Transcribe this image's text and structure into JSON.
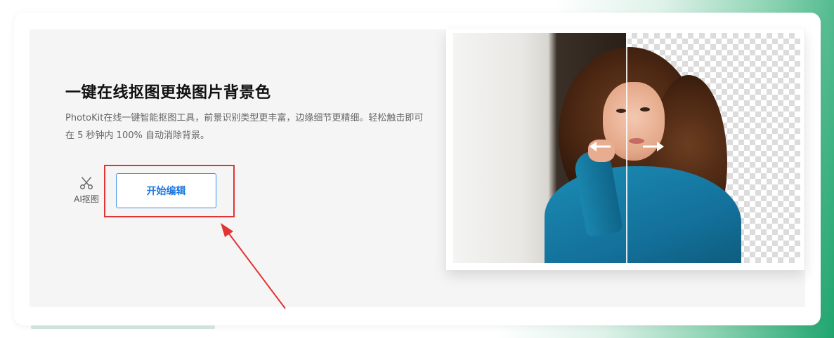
{
  "hero": {
    "title": "一键在线抠图更换图片背景色",
    "description": "PhotoKit在线一键智能抠图工具，前景识别类型更丰富，边缘细节更精细。轻松触击即可在 5 秒钟内 100% 自动消除背景。"
  },
  "tool": {
    "icon": "scissors-icon",
    "label": "AI抠图"
  },
  "actions": {
    "start_label": "开始编辑"
  },
  "annotation": {
    "highlight_color": "#e23434"
  },
  "preview": {
    "left_arrow_icon": "arrow-left-icon",
    "right_arrow_icon": "arrow-right-icon"
  },
  "colors": {
    "accent": "#1f79e0",
    "highlight": "#e23434",
    "background_gradient_end": "#1fa56e"
  }
}
